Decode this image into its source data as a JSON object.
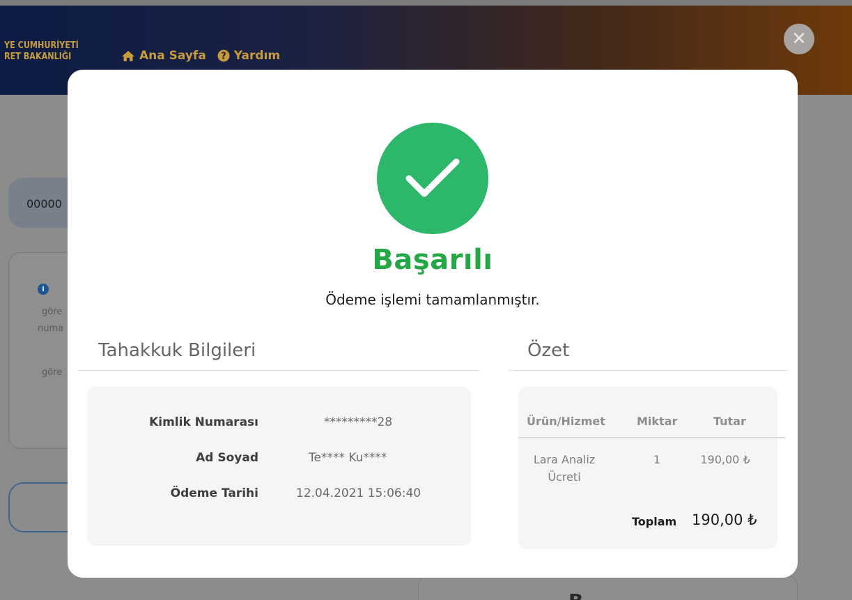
{
  "background": {
    "brand_line1": "YE CUMHURİYETİ",
    "brand_line2": "RET BAKANLIĞI",
    "nav": {
      "home_label": "Ana Sayfa",
      "help_label": "Yardım"
    },
    "pill_text": "00000",
    "info_icon": "i",
    "card_text_1": "göre",
    "card_text_2": "numa",
    "card_text_3": "göre",
    "bottom_letter": "B"
  },
  "modal": {
    "status_title": "Başarılı",
    "status_message": "Ödeme işlemi tamamlanmıştır.",
    "accent_color": "#2db76b",
    "title_color": "#25a745"
  },
  "accrual": {
    "title": "Tahakkuk Bilgileri",
    "rows": [
      {
        "label": "Kimlik Numarası",
        "value": "*********28"
      },
      {
        "label": "Ad Soyad",
        "value": "Te**** Ku****"
      },
      {
        "label": "Ödeme Tarihi",
        "value": "12.04.2021 15:06:40"
      }
    ]
  },
  "summary": {
    "title": "Özet",
    "columns": [
      "Ürün/Hizmet",
      "Miktar",
      "Tutar"
    ],
    "items": [
      {
        "product_line1": "Lara Analiz",
        "product_line2": "Ücreti",
        "quantity": "1",
        "amount": "190,00 ₺"
      }
    ],
    "total_label": "Toplam",
    "total_value": "190,00 ₺"
  }
}
